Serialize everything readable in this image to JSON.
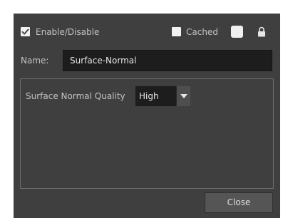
{
  "top_row": {
    "enable": {
      "label": "Enable/Disable",
      "checked": true
    },
    "cached": {
      "label": "Cached",
      "checked": false
    },
    "color_swatch": "#f0f0f0",
    "lock_icon": "lock-icon"
  },
  "name": {
    "label": "Name:",
    "value": "Surface-Normal"
  },
  "quality": {
    "label": "Surface Normal Quality",
    "value": "High",
    "arrow_icon": "dropdown-arrow-icon"
  },
  "footer": {
    "close_label": "Close"
  },
  "colors": {
    "panel_bg": "#3f3f3f",
    "field_bg": "#1d1d1d",
    "text": "#c2c2c2",
    "button_bg": "#555555"
  }
}
